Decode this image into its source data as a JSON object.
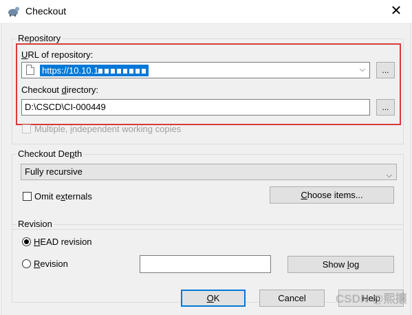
{
  "window": {
    "title": "Checkout",
    "close_glyph": "✕"
  },
  "repository": {
    "group_title": "Repository",
    "url_label_prefix": "",
    "url_label_key": "U",
    "url_label_rest": "RL of repository:",
    "url_value": "https://10.10.1",
    "url_chevron": "⌵",
    "browse_label": "...",
    "dir_label_prefix": "Checkout ",
    "dir_label_key": "d",
    "dir_label_rest": "irectory:",
    "dir_value": "D:\\CSCD\\CI-000449",
    "dir_browse_label": "...",
    "multiple_prefix": "Multiple, ",
    "multiple_key": "i",
    "multiple_rest": "ndependent working copies"
  },
  "depth": {
    "group_title_prefix": "Checkout De",
    "group_title_key": "p",
    "group_title_rest": "th",
    "selected": "Fully recursive",
    "chevron": "⌵",
    "omit_prefix": "Omit e",
    "omit_key": "x",
    "omit_rest": "ternals",
    "choose_key": "C",
    "choose_rest": "hoose items..."
  },
  "revision": {
    "group_title": "Revision",
    "head_key": "H",
    "head_rest": "EAD revision",
    "rev_key": "R",
    "rev_rest": "evision",
    "rev_value": "",
    "showlog_prefix": "Show ",
    "showlog_key": "l",
    "showlog_rest": "og"
  },
  "footer": {
    "ok_key": "O",
    "ok_rest": "K",
    "cancel_label": "Cancel",
    "help_label": "Help"
  },
  "watermark": "CSDN @熙攘",
  "icons": {
    "app": "tortoise-svn-icon",
    "close": "close-icon",
    "file": "file-icon"
  },
  "colors": {
    "highlight": "#0078d7",
    "annotation": "#d83a3a"
  }
}
